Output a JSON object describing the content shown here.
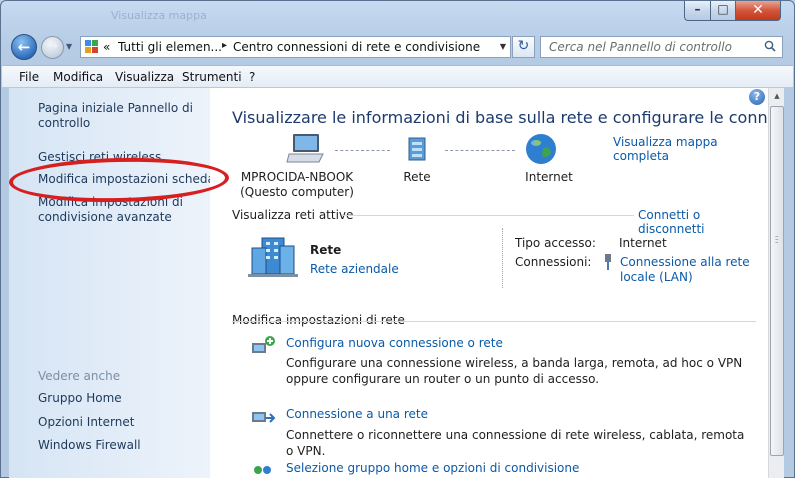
{
  "window": {
    "title": "Visualizza mappa",
    "controls": {
      "minimize": "–",
      "maximize": "□",
      "close": "✕"
    }
  },
  "nav": {
    "back_icon": "←",
    "forward_icon": "→"
  },
  "address": {
    "prefix": "«",
    "crumbs": [
      "Tutti gli elemen...",
      "Centro connessioni di rete e condivisione"
    ],
    "separator": "▸"
  },
  "search": {
    "placeholder": "Cerca nel Pannello di controllo"
  },
  "menu": [
    "File",
    "Modifica",
    "Visualizza",
    "Strumenti",
    "?"
  ],
  "sidebar": {
    "links": [
      "Pagina iniziale Pannello di controllo",
      "Gestisci reti wireless",
      "Modifica impostazioni scheda",
      "Modifica impostazioni di condivisione avanzate"
    ],
    "see_also_header": "Vedere anche",
    "see_also": [
      "Gruppo Home",
      "Opzioni Internet",
      "Windows Firewall"
    ]
  },
  "main": {
    "help": "?",
    "heading": "Visualizzare le informazioni di base sulla rete e configurare le connessioni",
    "map_link": "Visualizza mappa completa",
    "network_map": {
      "computer_name": "MPROCIDA-NBOOK",
      "computer_sub": "(Questo computer)",
      "network": "Rete",
      "internet": "Internet"
    },
    "active": {
      "title": "Visualizza reti attive",
      "connect_link": "Connetti o disconnetti",
      "network_name": "Rete",
      "network_type": "Rete aziendale",
      "access_label": "Tipo accesso:",
      "access_value": "Internet",
      "connections_label": "Connessioni:",
      "connection_link": "Connessione alla rete locale (LAN)"
    },
    "settings": {
      "title": "Modifica impostazioni di rete",
      "tasks": [
        {
          "link": "Configura nuova connessione o rete",
          "desc": "Configurare una connessione wireless, a banda larga, remota, ad hoc o VPN oppure configurare un router o un punto di accesso."
        },
        {
          "link": "Connessione a una rete",
          "desc": "Connettere o riconnettere una connessione di rete wireless, cablata, remota o VPN."
        },
        {
          "link": "Selezione gruppo home e opzioni di condivisione",
          "desc": ""
        }
      ]
    }
  },
  "colors": {
    "link": "#0a5aa8",
    "heading": "#1c3a6e",
    "annotation": "#d71f1f"
  }
}
